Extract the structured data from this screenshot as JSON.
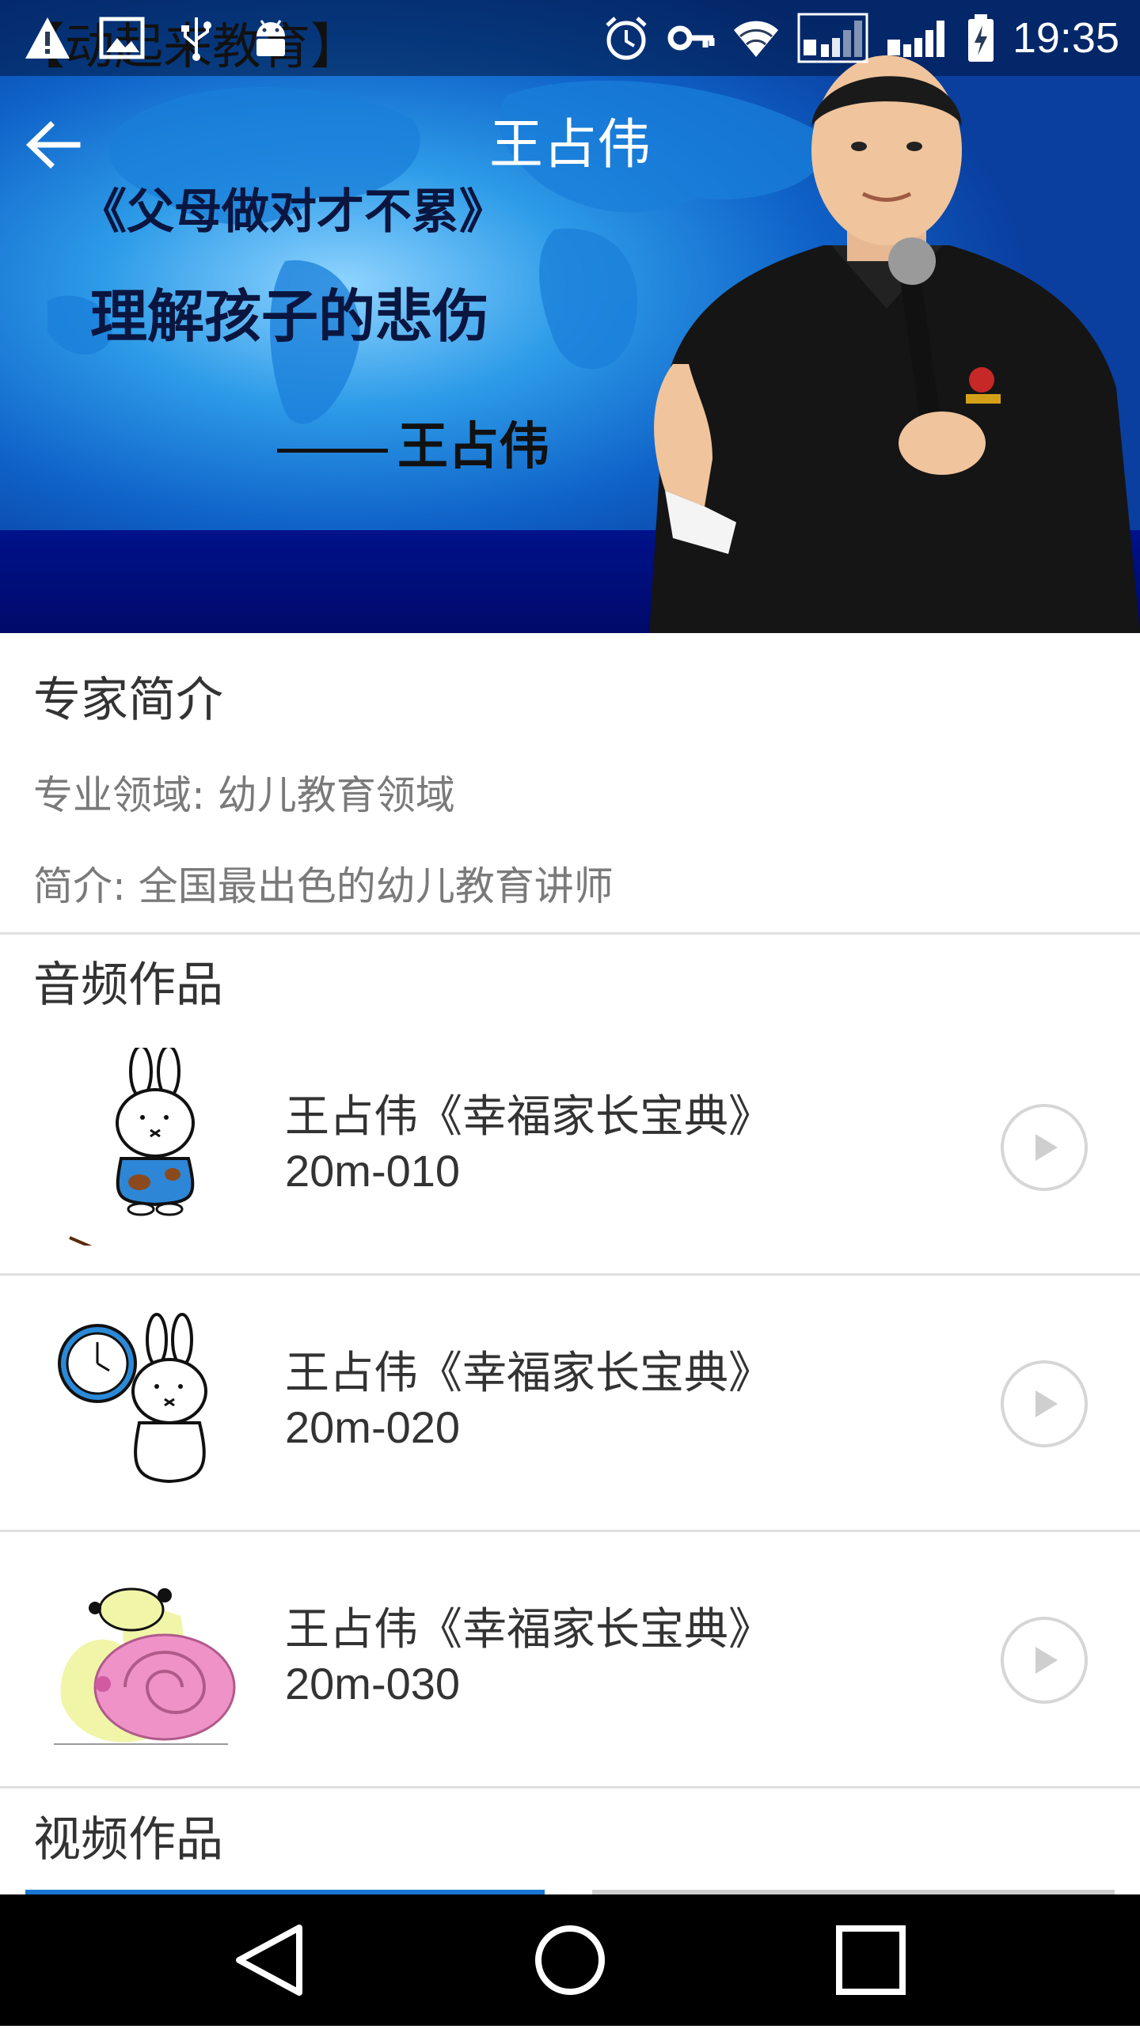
{
  "status_bar": {
    "time": "19:35",
    "left_icons": [
      "warning-icon",
      "image-icon",
      "usb-icon",
      "android-icon"
    ],
    "right_icons": [
      "alarm-icon",
      "vpn-key-icon",
      "wifi-icon",
      "sim1-signal-icon",
      "sim2-signal-icon",
      "battery-charging-icon"
    ]
  },
  "hero": {
    "brand_overlay": "【动起来教育】",
    "poster_title": "《父母做对才不累》",
    "poster_subtitle": "理解孩子的悲伤",
    "poster_signature": "王占伟"
  },
  "header": {
    "title": "王占伟",
    "back_icon": "arrow-back-icon"
  },
  "intro": {
    "heading": "专家简介",
    "field": "专业领域: 幼儿教育领域",
    "summary": "简介: 全国最出色的幼儿教育讲师"
  },
  "audio": {
    "heading": "音频作品",
    "items": [
      {
        "title": "王占伟《幸福家长宝典》",
        "code": "20m-010",
        "thumb_icon": "bunny-blue-shirt-icon"
      },
      {
        "title": "王占伟《幸福家长宝典》",
        "code": "20m-020",
        "thumb_icon": "bunny-clock-icon"
      },
      {
        "title": "王占伟《幸福家长宝典》",
        "code": "20m-030",
        "thumb_icon": "snail-icon"
      }
    ],
    "play_icon": "play-circle-icon"
  },
  "video": {
    "heading": "视频作品"
  },
  "nav": {
    "icons": [
      "nav-back-icon",
      "nav-home-icon",
      "nav-recents-icon"
    ]
  },
  "colors": {
    "hero_blue": "#0f62c8",
    "floor_navy": "#000a6a",
    "text_dark": "#333333",
    "text_gray": "#7a7a7a",
    "divider": "#e0e0e0",
    "video_tab_accent": "#1976d2"
  }
}
